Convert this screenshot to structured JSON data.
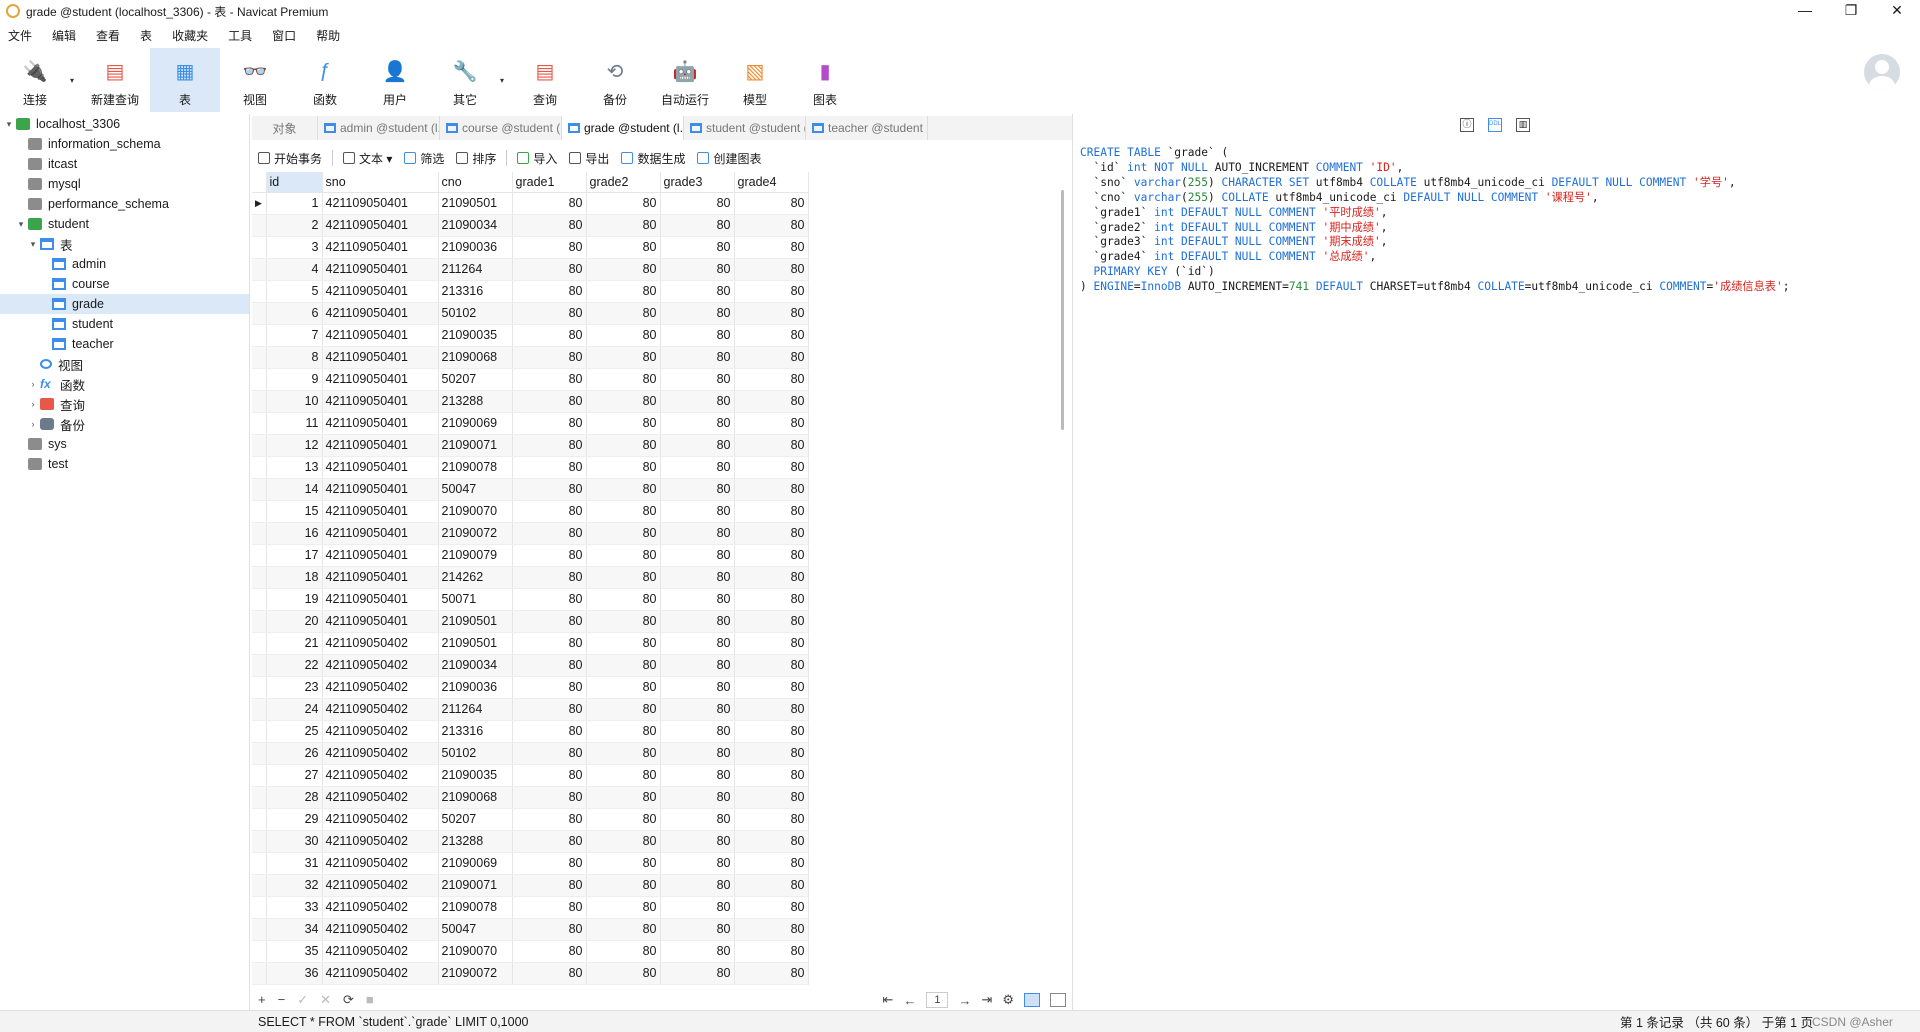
{
  "window": {
    "title": "grade @student (localhost_3306) - 表 - Navicat Premium",
    "controls": [
      "—",
      "❐",
      "✕"
    ]
  },
  "menu": [
    "文件",
    "编辑",
    "查看",
    "表",
    "收藏夹",
    "工具",
    "窗口",
    "帮助"
  ],
  "toolbar": [
    {
      "label": "连接",
      "icon": "plug-icon",
      "dropdown": true
    },
    {
      "label": "新建查询",
      "icon": "new-query-icon"
    },
    {
      "label": "表",
      "icon": "table-icon",
      "active": true
    },
    {
      "label": "视图",
      "icon": "view-icon"
    },
    {
      "label": "函数",
      "icon": "function-icon"
    },
    {
      "label": "用户",
      "icon": "user-icon"
    },
    {
      "label": "其它",
      "icon": "other-icon",
      "dropdown": true
    },
    {
      "label": "查询",
      "icon": "query-icon"
    },
    {
      "label": "备份",
      "icon": "backup-icon"
    },
    {
      "label": "自动运行",
      "icon": "robot-icon"
    },
    {
      "label": "模型",
      "icon": "model-icon"
    },
    {
      "label": "图表",
      "icon": "chart-icon"
    }
  ],
  "tree": [
    {
      "label": "localhost_3306",
      "level": 0,
      "icon": "conn",
      "arrow": "▾"
    },
    {
      "label": "information_schema",
      "level": 1,
      "icon": "db"
    },
    {
      "label": "itcast",
      "level": 1,
      "icon": "db"
    },
    {
      "label": "mysql",
      "level": 1,
      "icon": "db"
    },
    {
      "label": "performance_schema",
      "level": 1,
      "icon": "db"
    },
    {
      "label": "student",
      "level": 1,
      "icon": "db-green",
      "arrow": "▾"
    },
    {
      "label": "表",
      "level": 2,
      "icon": "table",
      "arrow": "▾"
    },
    {
      "label": "admin",
      "level": 3,
      "icon": "table"
    },
    {
      "label": "course",
      "level": 3,
      "icon": "table"
    },
    {
      "label": "grade",
      "level": 3,
      "icon": "table",
      "selected": true
    },
    {
      "label": "student",
      "level": 3,
      "icon": "table"
    },
    {
      "label": "teacher",
      "level": 3,
      "icon": "table"
    },
    {
      "label": "视图",
      "level": 2,
      "icon": "view"
    },
    {
      "label": "函数",
      "level": 2,
      "icon": "func",
      "arrow": "›"
    },
    {
      "label": "查询",
      "level": 2,
      "icon": "query",
      "arrow": "›"
    },
    {
      "label": "备份",
      "level": 2,
      "icon": "backup",
      "arrow": "›"
    },
    {
      "label": "sys",
      "level": 1,
      "icon": "db"
    },
    {
      "label": "test",
      "level": 1,
      "icon": "db"
    }
  ],
  "tabs": [
    {
      "label": "对象",
      "icon": false
    },
    {
      "label": "admin @student (l...",
      "icon": true
    },
    {
      "label": "course @student (l...",
      "icon": true
    },
    {
      "label": "grade @student (l...",
      "icon": true,
      "active": true
    },
    {
      "label": "student @student (...",
      "icon": true
    },
    {
      "label": "teacher @student (...",
      "icon": true
    }
  ],
  "gridtools": [
    {
      "label": "开始事务",
      "icon": "transaction-icon"
    },
    {
      "label": "文本 ▾",
      "icon": "text-icon"
    },
    {
      "label": "筛选",
      "icon": "filter-icon"
    },
    {
      "label": "排序",
      "icon": "sort-icon"
    },
    {
      "label": "导入",
      "icon": "import-icon"
    },
    {
      "label": "导出",
      "icon": "export-icon"
    },
    {
      "label": "数据生成",
      "icon": "datagen-icon"
    },
    {
      "label": "创建图表",
      "icon": "create-chart-icon"
    }
  ],
  "grid": {
    "columns": [
      "id",
      "sno",
      "cno",
      "grade1",
      "grade2",
      "grade3",
      "grade4"
    ],
    "rows": [
      [
        "1",
        "421109050401",
        "21090501",
        "80",
        "80",
        "80",
        "80"
      ],
      [
        "2",
        "421109050401",
        "21090034",
        "80",
        "80",
        "80",
        "80"
      ],
      [
        "3",
        "421109050401",
        "21090036",
        "80",
        "80",
        "80",
        "80"
      ],
      [
        "4",
        "421109050401",
        "211264",
        "80",
        "80",
        "80",
        "80"
      ],
      [
        "5",
        "421109050401",
        "213316",
        "80",
        "80",
        "80",
        "80"
      ],
      [
        "6",
        "421109050401",
        "50102",
        "80",
        "80",
        "80",
        "80"
      ],
      [
        "7",
        "421109050401",
        "21090035",
        "80",
        "80",
        "80",
        "80"
      ],
      [
        "8",
        "421109050401",
        "21090068",
        "80",
        "80",
        "80",
        "80"
      ],
      [
        "9",
        "421109050401",
        "50207",
        "80",
        "80",
        "80",
        "80"
      ],
      [
        "10",
        "421109050401",
        "213288",
        "80",
        "80",
        "80",
        "80"
      ],
      [
        "11",
        "421109050401",
        "21090069",
        "80",
        "80",
        "80",
        "80"
      ],
      [
        "12",
        "421109050401",
        "21090071",
        "80",
        "80",
        "80",
        "80"
      ],
      [
        "13",
        "421109050401",
        "21090078",
        "80",
        "80",
        "80",
        "80"
      ],
      [
        "14",
        "421109050401",
        "50047",
        "80",
        "80",
        "80",
        "80"
      ],
      [
        "15",
        "421109050401",
        "21090070",
        "80",
        "80",
        "80",
        "80"
      ],
      [
        "16",
        "421109050401",
        "21090072",
        "80",
        "80",
        "80",
        "80"
      ],
      [
        "17",
        "421109050401",
        "21090079",
        "80",
        "80",
        "80",
        "80"
      ],
      [
        "18",
        "421109050401",
        "214262",
        "80",
        "80",
        "80",
        "80"
      ],
      [
        "19",
        "421109050401",
        "50071",
        "80",
        "80",
        "80",
        "80"
      ],
      [
        "20",
        "421109050401",
        "21090501",
        "80",
        "80",
        "80",
        "80"
      ],
      [
        "21",
        "421109050402",
        "21090501",
        "80",
        "80",
        "80",
        "80"
      ],
      [
        "22",
        "421109050402",
        "21090034",
        "80",
        "80",
        "80",
        "80"
      ],
      [
        "23",
        "421109050402",
        "21090036",
        "80",
        "80",
        "80",
        "80"
      ],
      [
        "24",
        "421109050402",
        "211264",
        "80",
        "80",
        "80",
        "80"
      ],
      [
        "25",
        "421109050402",
        "213316",
        "80",
        "80",
        "80",
        "80"
      ],
      [
        "26",
        "421109050402",
        "50102",
        "80",
        "80",
        "80",
        "80"
      ],
      [
        "27",
        "421109050402",
        "21090035",
        "80",
        "80",
        "80",
        "80"
      ],
      [
        "28",
        "421109050402",
        "21090068",
        "80",
        "80",
        "80",
        "80"
      ],
      [
        "29",
        "421109050402",
        "50207",
        "80",
        "80",
        "80",
        "80"
      ],
      [
        "30",
        "421109050402",
        "213288",
        "80",
        "80",
        "80",
        "80"
      ],
      [
        "31",
        "421109050402",
        "21090069",
        "80",
        "80",
        "80",
        "80"
      ],
      [
        "32",
        "421109050402",
        "21090071",
        "80",
        "80",
        "80",
        "80"
      ],
      [
        "33",
        "421109050402",
        "21090078",
        "80",
        "80",
        "80",
        "80"
      ],
      [
        "34",
        "421109050402",
        "50047",
        "80",
        "80",
        "80",
        "80"
      ],
      [
        "35",
        "421109050402",
        "21090070",
        "80",
        "80",
        "80",
        "80"
      ],
      [
        "36",
        "421109050402",
        "21090072",
        "80",
        "80",
        "80",
        "80"
      ]
    ]
  },
  "gridfoot": {
    "left": [
      "+",
      "−",
      "✓",
      "✕",
      "⟳",
      "■"
    ],
    "nav": [
      "⇤",
      "←",
      "→",
      "⇥",
      "⚙"
    ],
    "page": "1"
  },
  "ddl_tools": [
    "ⓘ",
    "DDL",
    "▥"
  ],
  "ddl": [
    [
      [
        "kw",
        "CREATE TABLE"
      ],
      [
        "t",
        " `grade` ("
      ]
    ],
    [
      [
        "t",
        "  `id` "
      ],
      [
        "kw",
        "int NOT NULL"
      ],
      [
        "t",
        " AUTO_INCREMENT "
      ],
      [
        "kw",
        "COMMENT"
      ],
      [
        "t",
        " "
      ],
      [
        "str",
        "'ID'"
      ],
      [
        "t",
        ","
      ]
    ],
    [
      [
        "t",
        "  `sno` "
      ],
      [
        "kw",
        "varchar"
      ],
      [
        "t",
        "("
      ],
      [
        "nm",
        "255"
      ],
      [
        "t",
        ") "
      ],
      [
        "kw",
        "CHARACTER SET"
      ],
      [
        "t",
        " utf8mb4 "
      ],
      [
        "kw",
        "COLLATE"
      ],
      [
        "t",
        " utf8mb4_unicode_ci "
      ],
      [
        "kw",
        "DEFAULT NULL COMMENT"
      ],
      [
        "t",
        " "
      ],
      [
        "str",
        "'学号'"
      ],
      [
        "t",
        ","
      ]
    ],
    [
      [
        "t",
        "  `cno` "
      ],
      [
        "kw",
        "varchar"
      ],
      [
        "t",
        "("
      ],
      [
        "nm",
        "255"
      ],
      [
        "t",
        ") "
      ],
      [
        "kw",
        "COLLATE"
      ],
      [
        "t",
        " utf8mb4_unicode_ci "
      ],
      [
        "kw",
        "DEFAULT NULL COMMENT"
      ],
      [
        "t",
        " "
      ],
      [
        "str",
        "'课程号'"
      ],
      [
        "t",
        ","
      ]
    ],
    [
      [
        "t",
        "  `grade1` "
      ],
      [
        "kw",
        "int DEFAULT NULL COMMENT"
      ],
      [
        "t",
        " "
      ],
      [
        "str",
        "'平时成绩'"
      ],
      [
        "t",
        ","
      ]
    ],
    [
      [
        "t",
        "  `grade2` "
      ],
      [
        "kw",
        "int DEFAULT NULL COMMENT"
      ],
      [
        "t",
        " "
      ],
      [
        "str",
        "'期中成绩'"
      ],
      [
        "t",
        ","
      ]
    ],
    [
      [
        "t",
        "  `grade3` "
      ],
      [
        "kw",
        "int DEFAULT NULL COMMENT"
      ],
      [
        "t",
        " "
      ],
      [
        "str",
        "'期末成绩'"
      ],
      [
        "t",
        ","
      ]
    ],
    [
      [
        "t",
        "  `grade4` "
      ],
      [
        "kw",
        "int DEFAULT NULL COMMENT"
      ],
      [
        "t",
        " "
      ],
      [
        "str",
        "'总成绩'"
      ],
      [
        "t",
        ","
      ]
    ],
    [
      [
        "t",
        "  "
      ],
      [
        "kw",
        "PRIMARY KEY"
      ],
      [
        "t",
        " (`id`)"
      ]
    ],
    [
      [
        "t",
        ") "
      ],
      [
        "kw",
        "ENGINE"
      ],
      [
        "t",
        "="
      ],
      [
        "kw",
        "InnoDB"
      ],
      [
        "t",
        " AUTO_INCREMENT="
      ],
      [
        "nm",
        "741"
      ],
      [
        "t",
        " "
      ],
      [
        "kw",
        "DEFAULT"
      ],
      [
        "t",
        " CHARSET=utf8mb4 "
      ],
      [
        "kw",
        "COLLATE"
      ],
      [
        "t",
        "=utf8mb4_unicode_ci "
      ],
      [
        "kw",
        "COMMENT"
      ],
      [
        "t",
        "="
      ],
      [
        "str",
        "'成绩信息表'"
      ],
      [
        "t",
        ";"
      ]
    ]
  ],
  "status": {
    "sql": "SELECT * FROM `student`.`grade` LIMIT 0,1000",
    "info": "第 1 条记录 （共 60 条） 于第 1 页",
    "watermark": "CSDN @Asher"
  },
  "colors": {
    "accent": "#3c8ee8",
    "selection": "#dbe8f7",
    "keyword": "#1f6fd9",
    "string": "#d8231d",
    "number": "#2a8a3a"
  }
}
